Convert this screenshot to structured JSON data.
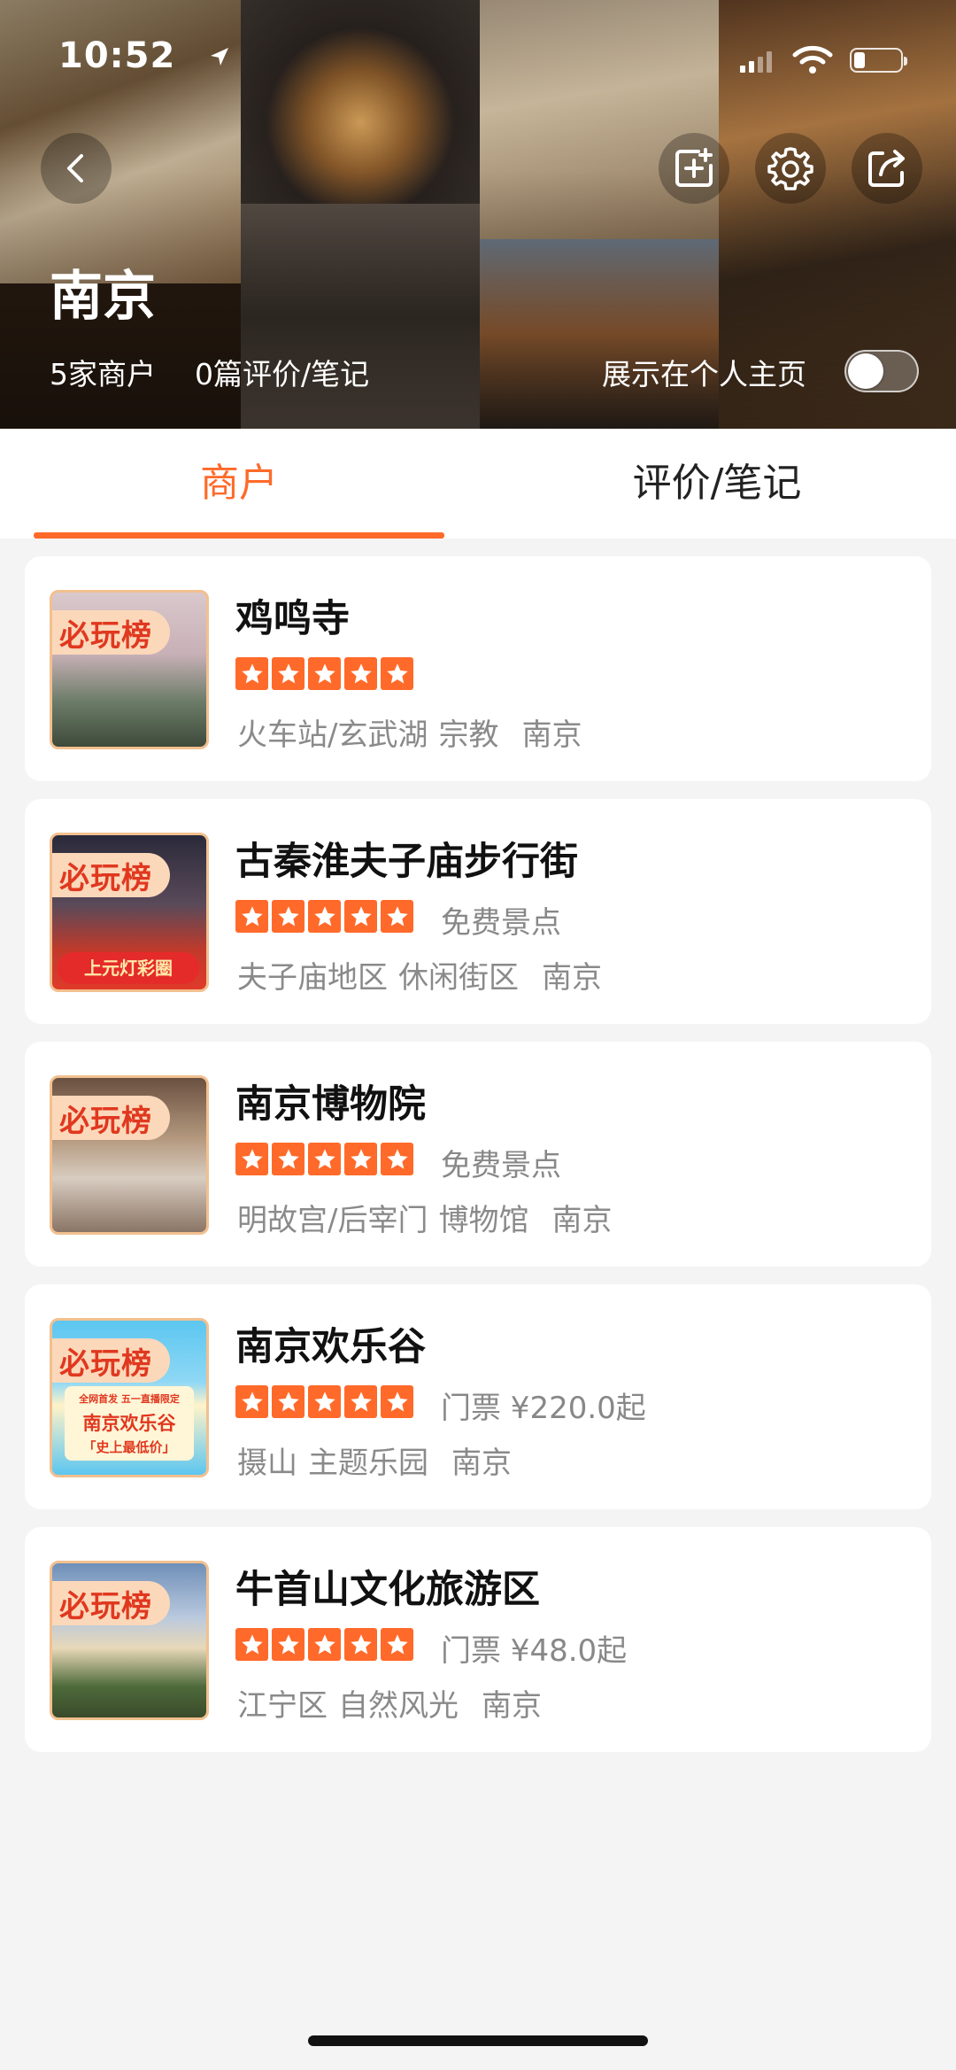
{
  "status_bar": {
    "time": "10:52"
  },
  "header": {
    "city": "南京",
    "merchant_count": "5家商户",
    "review_count": "0篇评价/笔记",
    "show_on_profile_label": "展示在个人主页",
    "show_on_profile_enabled": false
  },
  "tabs": [
    {
      "label": "商户",
      "active": true
    },
    {
      "label": "评价/笔记",
      "active": false
    }
  ],
  "badge_label": "必玩榜",
  "rating_stars": 5,
  "accent_color": "#ff6a2a",
  "merchants": [
    {
      "name": "鸡鸣寺",
      "price": "",
      "area": "火车站/玄武湖",
      "category": "宗教",
      "city": "南京"
    },
    {
      "name": "古秦淮夫子庙步行街",
      "price": "免费景点",
      "area": "夫子庙地区",
      "category": "休闲街区",
      "city": "南京",
      "thumb_caption": "上元灯彩圈"
    },
    {
      "name": "南京博物院",
      "price": "免费景点",
      "area": "明故宫/后宰门",
      "category": "博物馆",
      "city": "南京"
    },
    {
      "name": "南京欢乐谷",
      "price": "门票 ¥220.0起",
      "area": "摄山",
      "category": "主题乐园",
      "city": "南京",
      "thumb_lines": [
        "全网首发 五一直播限定",
        "南京欢乐谷",
        "「史上最低价」"
      ]
    },
    {
      "name": "牛首山文化旅游区",
      "price": "门票 ¥48.0起",
      "area": "江宁区",
      "category": "自然风光",
      "city": "南京"
    }
  ]
}
